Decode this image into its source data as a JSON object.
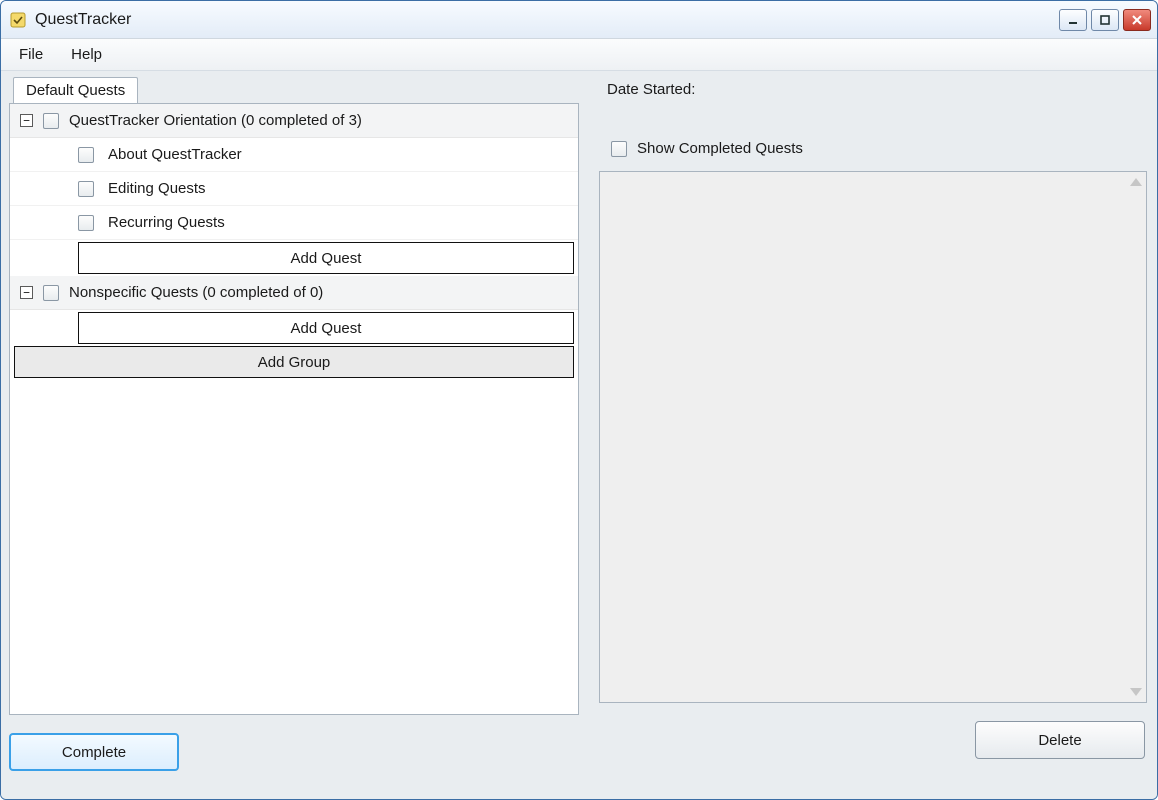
{
  "window": {
    "title": "QuestTracker"
  },
  "menu": {
    "file": "File",
    "help": "Help"
  },
  "tabs": {
    "default": "Default Quests"
  },
  "tree": {
    "groups": [
      {
        "label": "QuestTracker Orientation (0 completed of 3)",
        "items": [
          {
            "label": "About QuestTracker"
          },
          {
            "label": "Editing Quests"
          },
          {
            "label": "Recurring Quests"
          }
        ],
        "add_quest_label": "Add Quest"
      },
      {
        "label": "Nonspecific Quests (0 completed of 0)",
        "items": [],
        "add_quest_label": "Add Quest"
      }
    ],
    "add_group_label": "Add Group"
  },
  "right": {
    "date_started_label": "Date Started:",
    "show_completed_label": "Show Completed Quests"
  },
  "buttons": {
    "complete": "Complete",
    "delete": "Delete"
  },
  "icons": {
    "expander_minus": "−"
  }
}
